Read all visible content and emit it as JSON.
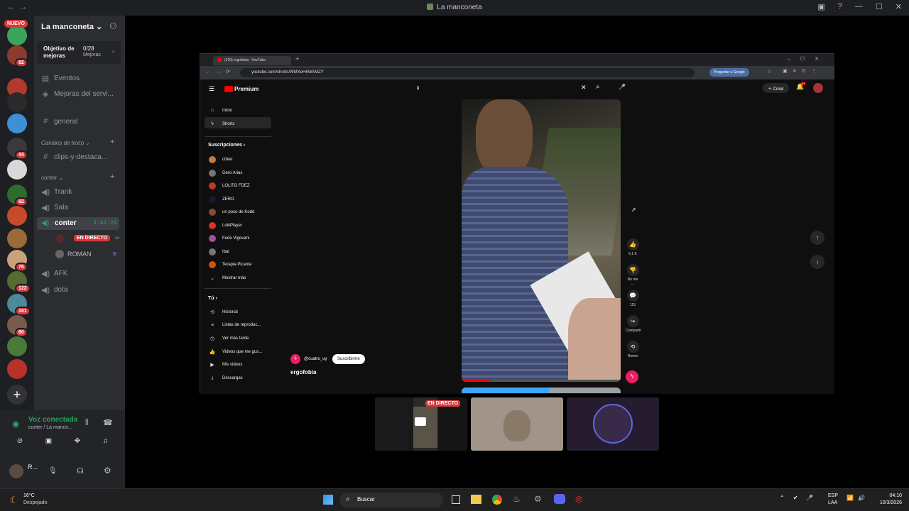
{
  "window": {
    "title": "La manconeta"
  },
  "rail": {
    "new_badge": "NUEVO",
    "servers": [
      {
        "color": "#8e3b2f",
        "badge": "82"
      },
      {
        "color": "#b03a2e",
        "badge": ""
      },
      {
        "color": "#2a2a2a",
        "badge": ""
      },
      {
        "color": "#3d8fd6",
        "badge": ""
      },
      {
        "color": "#3a3a3a",
        "badge": "44"
      },
      {
        "color": "#d8d8d8",
        "badge": ""
      },
      {
        "color": "#2f6a2f",
        "badge": "82"
      },
      {
        "color": "#c94a2a",
        "badge": ""
      },
      {
        "color": "#9a6a3a",
        "badge": ""
      },
      {
        "color": "#c9a27a",
        "badge": "76"
      },
      {
        "color": "#556b2f",
        "badge": "122"
      },
      {
        "color": "#4a8a9a",
        "badge": "181"
      },
      {
        "color": "#7a5a4a",
        "badge": "80"
      },
      {
        "color": "#4a7a3a",
        "badge": ""
      },
      {
        "color": "#b8322a",
        "badge": ""
      }
    ]
  },
  "server": {
    "name": "La manconeta",
    "goal_label": "Objetivo de mejoras",
    "goal_value": "0/28",
    "goal_unit": "Mejoras",
    "events": "Eventos",
    "boosts": "Mejoras del servi...",
    "general": "general",
    "cat_text": "Canales de texto",
    "clips": "clips-y-destaca...",
    "cat_conter": "conter",
    "voice": [
      "Trank",
      "Sala",
      "conter",
      "AFK",
      "dota"
    ],
    "conter_time": "3:42:24",
    "live_badge": "EN DIRECTO",
    "member": "ROMAN"
  },
  "user_panel": {
    "voice_status": "Voz conectada",
    "voice_channel": "conter / La manco...",
    "user_initial": "R..."
  },
  "browser": {
    "tab_title": "(220) ergofobia - YouTube",
    "url": "youtube.com/shorts/WMXeH6WAMZY",
    "ask_google": "Preguntar a Google"
  },
  "youtube": {
    "logo": "Premium",
    "search_value": "g",
    "create": "Crear",
    "notif_badge": "9+",
    "nav": [
      "Inicio",
      "Shorts"
    ],
    "subs_header": "Suscripciones",
    "subs": [
      "c0ker",
      "Gero Arias",
      "LOLITO FDEZ",
      "ZERO",
      "un poco de Kodd",
      "LokiPlayer",
      "Fede Vigevani",
      "Ibai",
      "Terapia Picante"
    ],
    "sub_colors": [
      "#c97a3a",
      "#777777",
      "#c0392b",
      "#1a1a2e",
      "#8a4a3a",
      "#d93025",
      "#a0529a",
      "#777777",
      "#d35400"
    ],
    "show_more": "Mostrar más",
    "you_header": "Tú",
    "you_items": [
      "Historial",
      "Listas de reproduc...",
      "Ver más tarde",
      "Videos que me gus...",
      "Mis videos",
      "Descargas"
    ],
    "channel_handle": "@cuatro_uy",
    "subscribe": "Suscribirme",
    "video_title": "ergofobia",
    "likes": "6,1 K",
    "dislike_label": "No me ...",
    "comments": "115",
    "share": "Compartir",
    "remix": "Remix"
  },
  "stream_tiles": {
    "live_badge": "EN DIRECTO"
  },
  "taskbar": {
    "temp": "16°C",
    "weather": "Despejado",
    "search": "Buscar",
    "lang1": "ESP",
    "lang2": "LAA",
    "time": "04:10",
    "date": "10/3/2026"
  }
}
